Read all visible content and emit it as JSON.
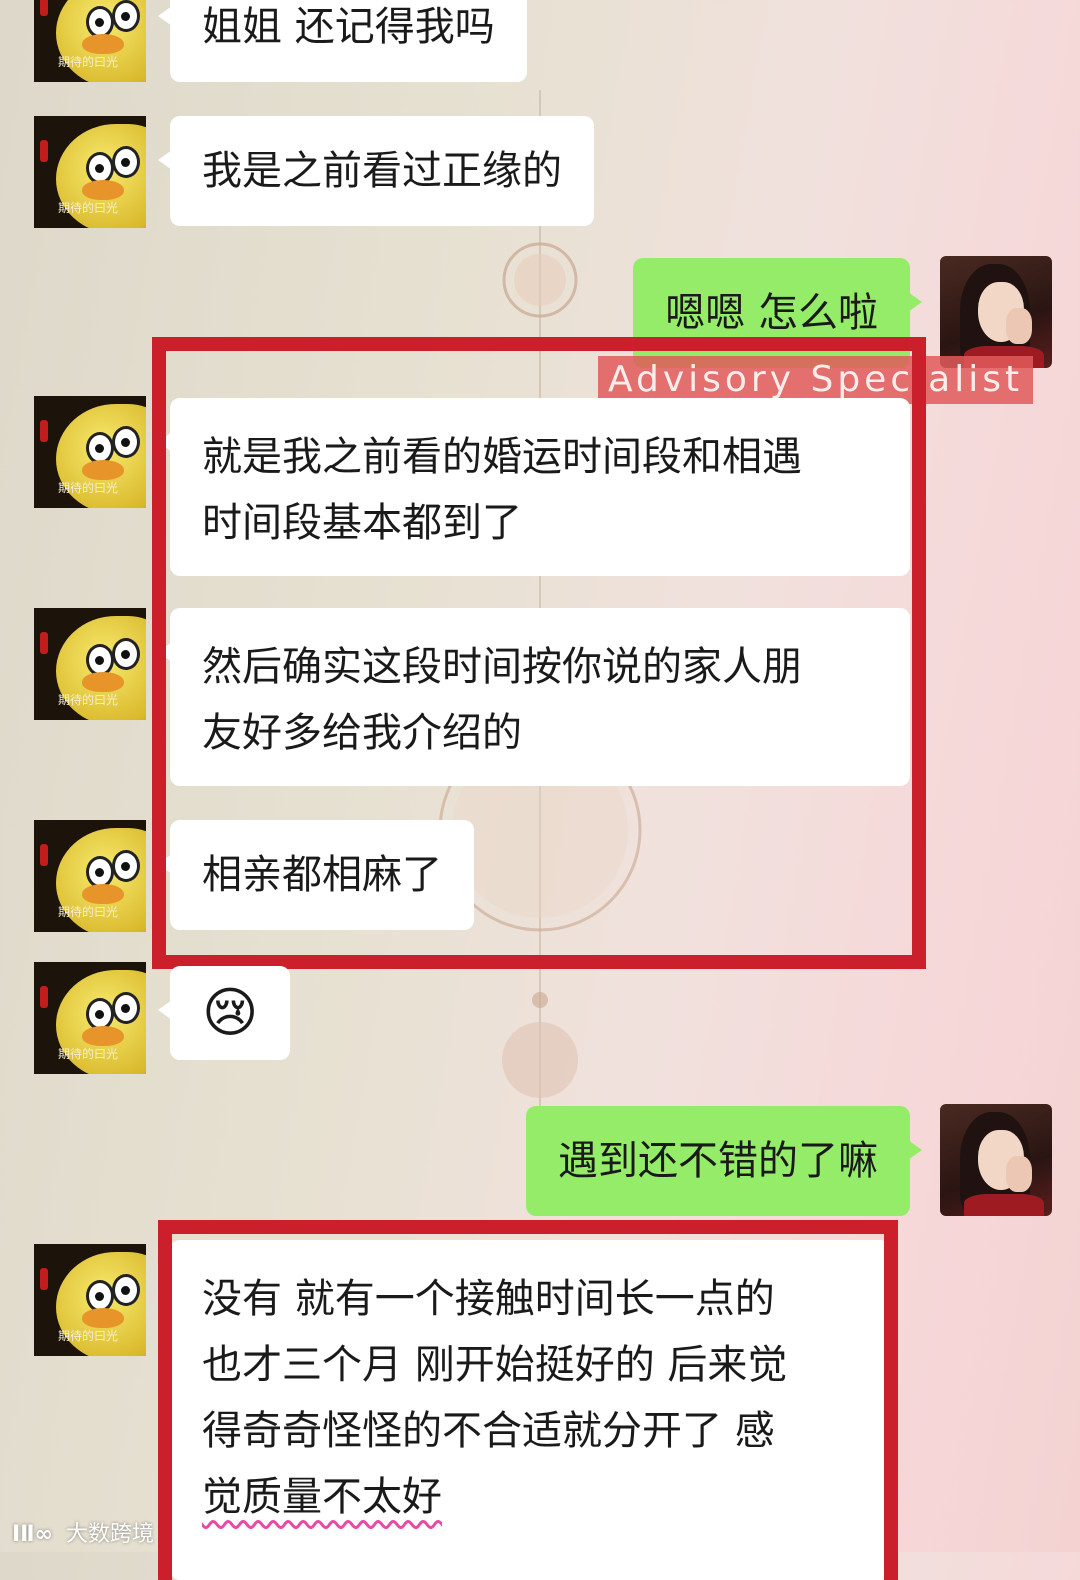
{
  "contact": {
    "avatar_caption": "期待的曰光"
  },
  "messages": [
    {
      "id": "m1",
      "sender": "them",
      "text": "姐姐 还记得我吗"
    },
    {
      "id": "m2",
      "sender": "them",
      "text": "我是之前看过正缘的"
    },
    {
      "id": "m3",
      "sender": "me",
      "text": "嗯嗯 怎么啦"
    },
    {
      "id": "m4",
      "sender": "them",
      "lines": [
        "就是我之前看的婚运时间段和相遇",
        "时间段基本都到了"
      ]
    },
    {
      "id": "m5",
      "sender": "them",
      "lines": [
        "然后确实这段时间按你说的家人朋",
        "友好多给我介绍的"
      ]
    },
    {
      "id": "m6",
      "sender": "them",
      "text": "相亲都相麻了"
    },
    {
      "id": "m7",
      "sender": "them",
      "emoji": "😢"
    },
    {
      "id": "m8",
      "sender": "me",
      "text": "遇到还不错的了嘛"
    },
    {
      "id": "m9",
      "sender": "them",
      "lines": [
        "没有 就有一个接触时间长一点的",
        "也才三个月 刚开始挺好的 后来觉",
        "得奇奇怪怪的不合适就分开了 感"
      ],
      "underlined_tail": "觉质量不太好"
    }
  ],
  "watermark": "Advisory Specialist",
  "footer_brand": {
    "logo": "ⅠⅡ∞",
    "name": "大数跨境"
  },
  "colors": {
    "highlight_border": "#cc1f2c",
    "my_bubble": "#95ec69",
    "their_bubble": "#ffffff",
    "wavy_underline": "#e84aa6"
  },
  "icons": {
    "their_avatar": "yellow-chick-avatar",
    "my_avatar": "woman-portrait-avatar",
    "crying_emoji": "crying-face-emoji"
  }
}
